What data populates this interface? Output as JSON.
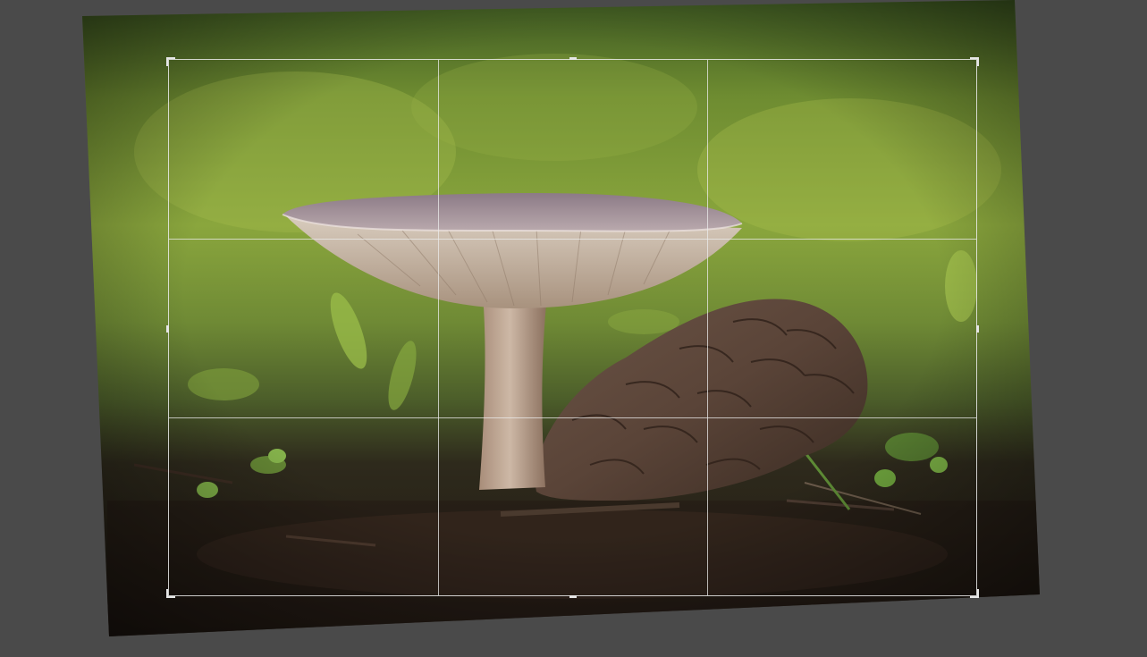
{
  "editor": {
    "mode": "crop",
    "overlay": "rule-of-thirds-grid",
    "background_color": "#4a4a4a"
  },
  "photo": {
    "subject": "mushroom-and-pinecone",
    "rotated": true
  },
  "crop": {
    "handles": [
      "top-left",
      "top",
      "top-right",
      "right",
      "bottom-right",
      "bottom",
      "bottom-left",
      "left"
    ],
    "grid_color": "#ebebeb"
  }
}
